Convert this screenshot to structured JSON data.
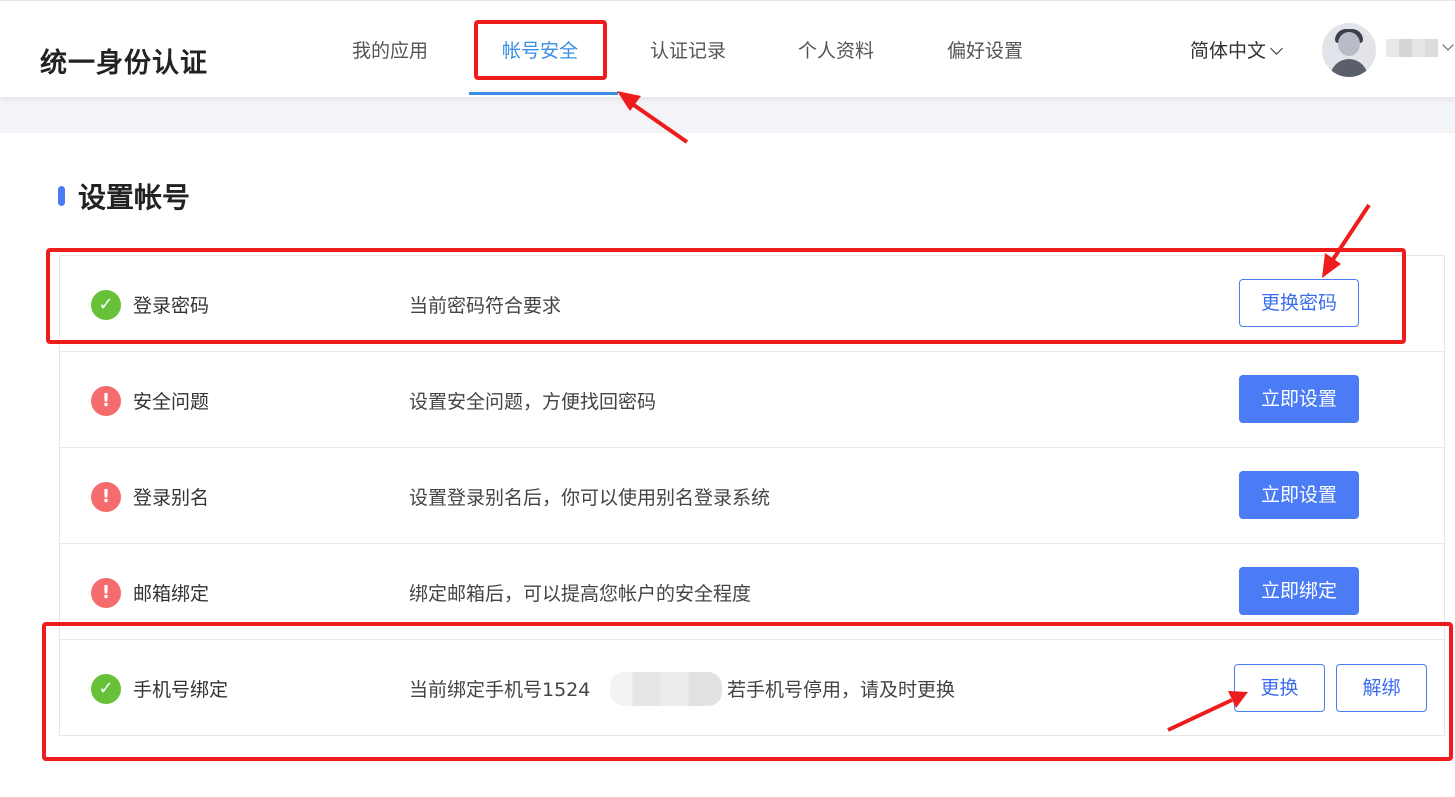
{
  "header": {
    "logo": "统一身份认证",
    "tabs": [
      {
        "label": "我的应用"
      },
      {
        "label": "帐号安全",
        "active": true
      },
      {
        "label": "认证记录"
      },
      {
        "label": "个人资料"
      },
      {
        "label": "偏好设置"
      }
    ],
    "language": "简体中文",
    "language_icon": "chevron-down-icon",
    "avatar_icon": "user-avatar-icon"
  },
  "section": {
    "title": "设置帐号"
  },
  "rows": [
    {
      "status": "ok",
      "status_icon": "check-circle-icon",
      "label": "登录密码",
      "desc": "当前密码符合要求",
      "buttons": [
        "更换密码"
      ]
    },
    {
      "status": "warn",
      "status_icon": "exclamation-circle-icon",
      "label": "安全问题",
      "desc": "设置安全问题，方便找回密码",
      "buttons": [
        "立即设置"
      ]
    },
    {
      "status": "warn",
      "status_icon": "exclamation-circle-icon",
      "label": "登录别名",
      "desc": "设置登录别名后，你可以使用别名登录系统",
      "buttons": [
        "立即设置"
      ]
    },
    {
      "status": "warn",
      "status_icon": "exclamation-circle-icon",
      "label": "邮箱绑定",
      "desc": "绑定邮箱后，可以提高您帐户的安全程度",
      "buttons": [
        "立即绑定"
      ]
    },
    {
      "status": "ok",
      "status_icon": "check-circle-icon",
      "label": "手机号绑定",
      "desc": "当前绑定手机号1524",
      "desc_suffix": "若手机号停用，请及时更换",
      "buttons": [
        "更换",
        "解绑"
      ]
    }
  ],
  "colors": {
    "accent": "#4b7bf5",
    "active_tab": "#3a8ee6",
    "ok": "#67c23a",
    "warn": "#f56c6c",
    "highlight": "#ee1c1c"
  }
}
